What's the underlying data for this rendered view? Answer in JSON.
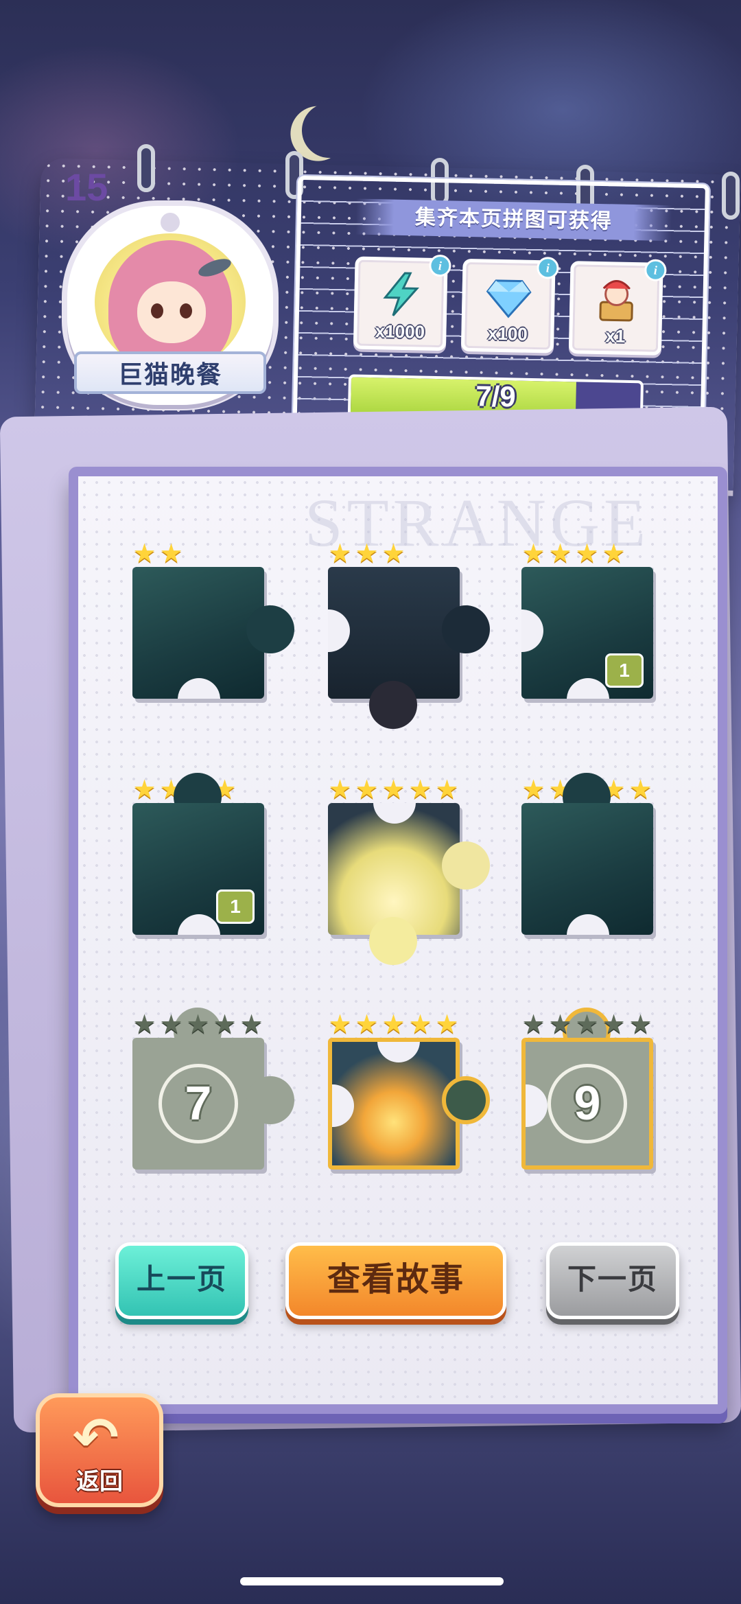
{
  "page_number": "15",
  "chapter": {
    "title": "巨猫晚餐"
  },
  "rewards": {
    "title": "集齐本页拼图可获得",
    "items": [
      {
        "icon": "lightning-icon",
        "qty": "x1000"
      },
      {
        "icon": "diamond-icon",
        "qty": "x100"
      },
      {
        "icon": "jester-box-icon",
        "qty": "x1"
      }
    ],
    "progress": {
      "text": "7/9",
      "collected": 7,
      "total": 9
    }
  },
  "watermark": "STRANGE",
  "pieces": [
    {
      "stars": 2,
      "locked": false,
      "count": ""
    },
    {
      "stars": 3,
      "locked": false,
      "count": ""
    },
    {
      "stars": 4,
      "locked": false,
      "count": "1"
    },
    {
      "stars": 4,
      "locked": false,
      "count": "1"
    },
    {
      "stars": 5,
      "locked": false,
      "count": ""
    },
    {
      "stars": 5,
      "locked": false,
      "count": ""
    },
    {
      "stars": 5,
      "locked": true,
      "number": "7"
    },
    {
      "stars": 5,
      "locked": false,
      "count": ""
    },
    {
      "stars": 5,
      "locked": true,
      "number": "9"
    }
  ],
  "buttons": {
    "prev": "上一页",
    "story": "查看故事",
    "next": "下一页"
  },
  "back": {
    "label": "返回",
    "icon": "back-arrow-icon"
  },
  "colors": {
    "accent_gold": "#ffd43a",
    "progress_fill": "#a8d43d",
    "frame": "#9a8fd0"
  }
}
